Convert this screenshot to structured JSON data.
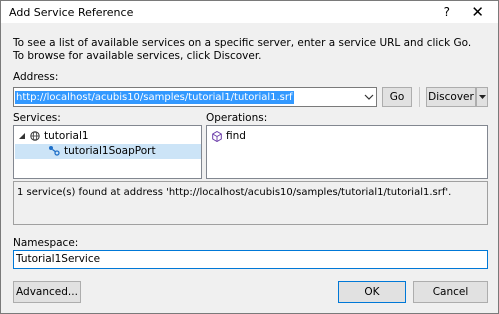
{
  "window": {
    "title": "Add Service Reference",
    "help_glyph": "?",
    "close_glyph": "✕"
  },
  "description": "To see a list of available services on a specific server, enter a service URL and click Go. To browse for available services, click Discover.",
  "address": {
    "label": "Address:",
    "value": "http://localhost/acubis10/samples/tutorial1/tutorial1.srf",
    "go_label": "Go",
    "discover_label": "Discover"
  },
  "services": {
    "label": "Services:",
    "items": [
      {
        "label": "tutorial1",
        "icon": "globe-icon",
        "expanded": true
      },
      {
        "label": "tutorial1SoapPort",
        "icon": "service-port-icon",
        "selected": true
      }
    ]
  },
  "operations": {
    "label": "Operations:",
    "items": [
      {
        "label": "find",
        "icon": "method-icon"
      }
    ]
  },
  "status_text": "1 service(s) found at address 'http://localhost/acubis10/samples/tutorial1/tutorial1.srf'.",
  "namespace": {
    "label": "Namespace:",
    "value": "Tutorial1Service"
  },
  "buttons": {
    "advanced_label": "Advanced...",
    "ok_label": "OK",
    "cancel_label": "Cancel"
  }
}
